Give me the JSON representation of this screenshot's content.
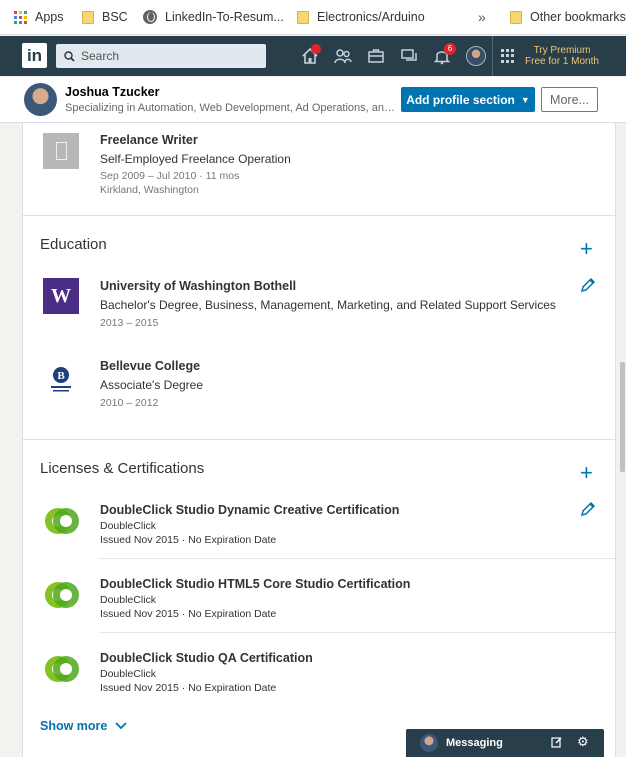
{
  "bookmarks": {
    "apps": "Apps",
    "bsc": "BSC",
    "linkedin_to_resume": "LinkedIn-To-Resum...",
    "electronics": "Electronics/Arduino",
    "overflow": "»",
    "other": "Other bookmarks"
  },
  "nav": {
    "logo": "in",
    "search_placeholder": "Search",
    "notifications_badge": "6",
    "premium": "Try Premium Free for 1 Month"
  },
  "profile_header": {
    "name": "Joshua Tzucker",
    "headline": "Specializing in Automation, Web Development, Ad Operations, and Di...",
    "add_section": "Add profile section",
    "more": "More..."
  },
  "experience": {
    "title": "Freelance Writer",
    "company": "Self-Employed Freelance Operation",
    "dates": "Sep 2009 – Jul 2010 · 11 mos",
    "location": "Kirkland, Washington"
  },
  "education": {
    "heading": "Education",
    "items": [
      {
        "school": "University of Washington Bothell",
        "degree": "Bachelor's Degree, Business, Management, Marketing, and Related Support Services",
        "dates": "2013 – 2015",
        "logo_text": "W"
      },
      {
        "school": "Bellevue College",
        "degree": "Associate's Degree",
        "dates": "2010 – 2012"
      }
    ]
  },
  "licenses": {
    "heading": "Licenses & Certifications",
    "items": [
      {
        "name": "DoubleClick Studio Dynamic Creative Certification",
        "issuer": "DoubleClick",
        "issued": "Issued Nov 2015 · No Expiration Date"
      },
      {
        "name": "DoubleClick Studio HTML5 Core Studio Certification",
        "issuer": "DoubleClick",
        "issued": "Issued Nov 2015 · No Expiration Date"
      },
      {
        "name": "DoubleClick Studio QA Certification",
        "issuer": "DoubleClick",
        "issued": "Issued Nov 2015 · No Expiration Date"
      }
    ],
    "show_more": "Show more"
  },
  "messaging": {
    "label": "Messaging"
  },
  "colors": {
    "linkedin_blue": "#0073b1",
    "nav_bg": "#283e4a",
    "premium_gold": "#f0c473",
    "doubleclick_green": "#84c225",
    "uw_purple": "#4b2e83"
  },
  "icons": [
    "apps-grid-icon",
    "folder-icon",
    "globe-icon",
    "search-icon",
    "home-icon",
    "network-icon",
    "jobs-icon",
    "messages-icon",
    "bell-icon",
    "work-grid-icon",
    "plus-icon",
    "pencil-icon",
    "chevron-down-icon",
    "compose-icon",
    "gear-icon"
  ]
}
